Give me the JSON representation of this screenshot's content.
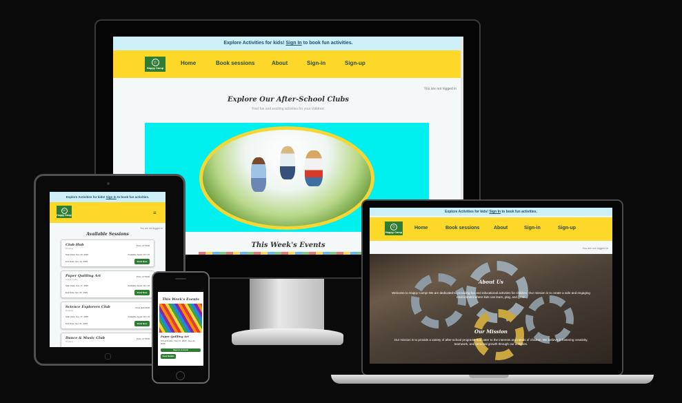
{
  "colors": {
    "nav": "#fdd829",
    "notice": "#cdeff7",
    "button": "#2e7d32",
    "hero_bg": "#00f0f0",
    "hero_ring": "#f5d633"
  },
  "site": {
    "notice_prefix": "Explore Activities for kids!",
    "notice_link": "Sign In",
    "notice_suffix": "to book fun activities.",
    "logo_icon": "smiley-icon",
    "logo_text": "Happy Camp",
    "nav": [
      "Home",
      "Book sessions",
      "About",
      "Sign-in",
      "Sign-up"
    ],
    "login_status": "You are not logged in",
    "menu_icon": "hamburger-icon"
  },
  "desktop": {
    "heading": "Explore Our After-School Clubs",
    "subheading": "Find fun and exciting activities for your children!",
    "events_heading": "This Week's Events"
  },
  "tablet": {
    "heading": "Available Sessions",
    "cards": [
      {
        "name": "Club Hub",
        "category": "Reading",
        "price": "Price: £7.50/D",
        "start": "Start Date: Nov 10, 2025",
        "spots": "Available Seats: 15 / 15",
        "end": "End Date: Nov 14, 2025",
        "button": "Book Now"
      },
      {
        "name": "Paper Quilling Art",
        "category": "Arts & Crafts",
        "price": "Price: £7.50/D",
        "start": "Start Date: Nov 17, 2025",
        "spots": "Available Seats: 10 / 10",
        "end": "End Date: Nov 21, 2025",
        "button": "Book Now"
      },
      {
        "name": "Science Explorers Club",
        "category": "Reading",
        "price": "Price: £10.00/D",
        "start": "Start Date: Nov 17, 2025",
        "spots": "Available Seats: 15 / 15",
        "end": "End Date: Nov 21, 2025",
        "button": "Book Now"
      },
      {
        "name": "Dance & Music Club",
        "category": "Creative",
        "price": "Price: £7.50/D",
        "start": "",
        "spots": "",
        "end": "",
        "button": ""
      }
    ]
  },
  "phone": {
    "heading": "This Week's Events",
    "event_name": "Paper Quilling Art",
    "event_meta": "Arts & Crafts · Nov 17, 2025 - Nov 21, 2025",
    "signin_label": "Sign in to book",
    "details_button": "View Details"
  },
  "laptop": {
    "about_heading": "About Us",
    "about_text": "Welcome to Happy Camp! We are dedicated to providing fun and educational activities for children. Our mission is to create a safe and engaging environment where kids can learn, play, and grow.",
    "mission_heading": "Our Mission",
    "mission_text": "Our mission is to provide a variety of after-school programs that cater to the interests and needs of children. We believe in fostering creativity, teamwork, and personal growth through our activities."
  }
}
